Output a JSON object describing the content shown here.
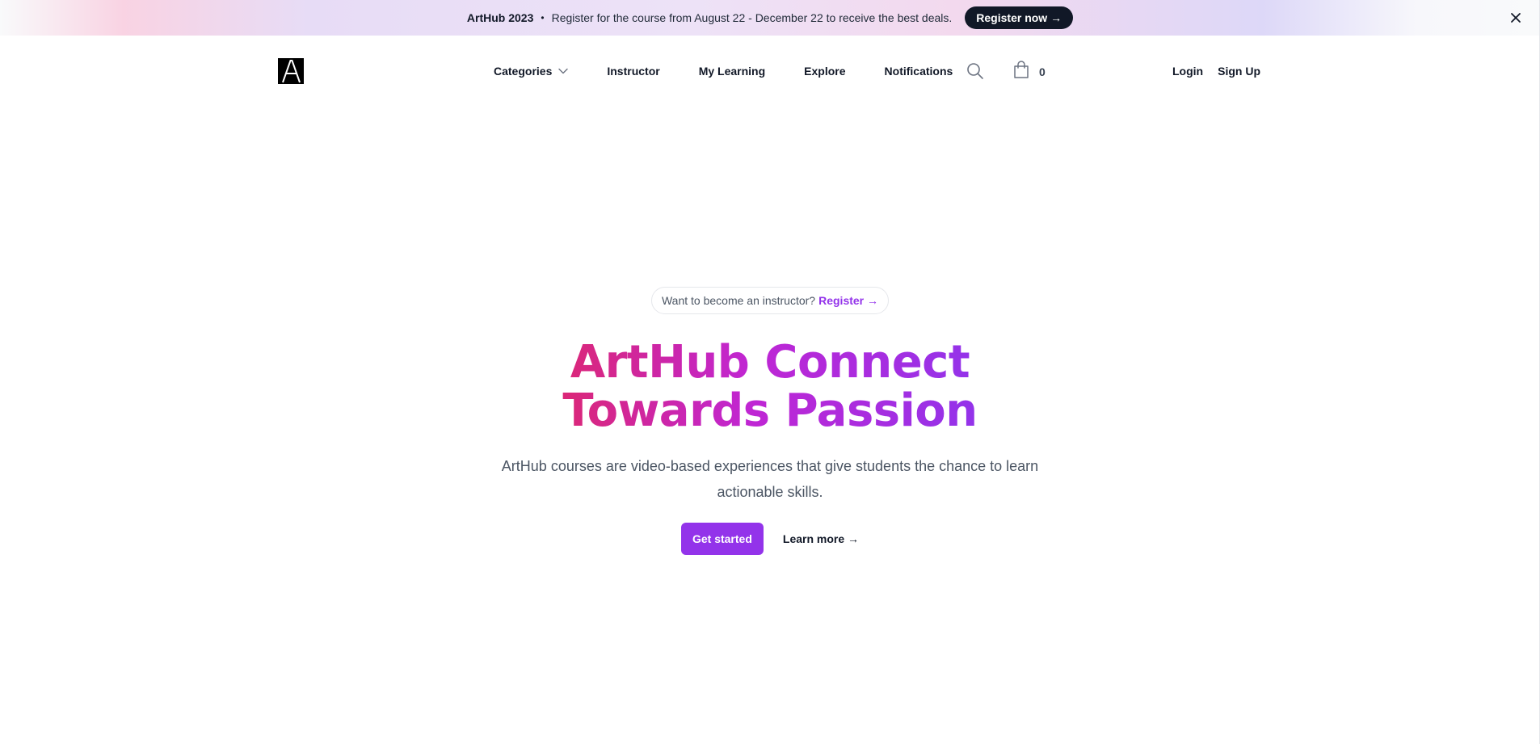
{
  "banner": {
    "title": "ArtHub 2023",
    "dot": "•",
    "message": "Register for the course from August 22 - December 22 to receive the best deals.",
    "cta": "Register now →",
    "close_icon": "close-icon"
  },
  "navbar": {
    "logo_letter": "A",
    "links": [
      "Categories",
      "Instructor",
      "My Learning",
      "Explore",
      "Notifications"
    ],
    "search_icon": "search-icon",
    "cart_icon": "shopping-bag-icon",
    "cart_count": "0",
    "login": "Login",
    "signup": "Sign Up"
  },
  "hero": {
    "pill_text": "Want to become an instructor?",
    "pill_link": "Register →",
    "headline_line1": "ArtHub Connect",
    "headline_line2": "Towards Passion",
    "subtext": "ArtHub courses are video-based experiences that give students the chance to learn actionable skills.",
    "primary_cta": "Get started",
    "secondary_cta": "Learn more →"
  },
  "colors": {
    "accent": "#9333ea",
    "headline_start": "#db2777",
    "headline_end": "#9333ea",
    "banner_button": "#111827"
  }
}
